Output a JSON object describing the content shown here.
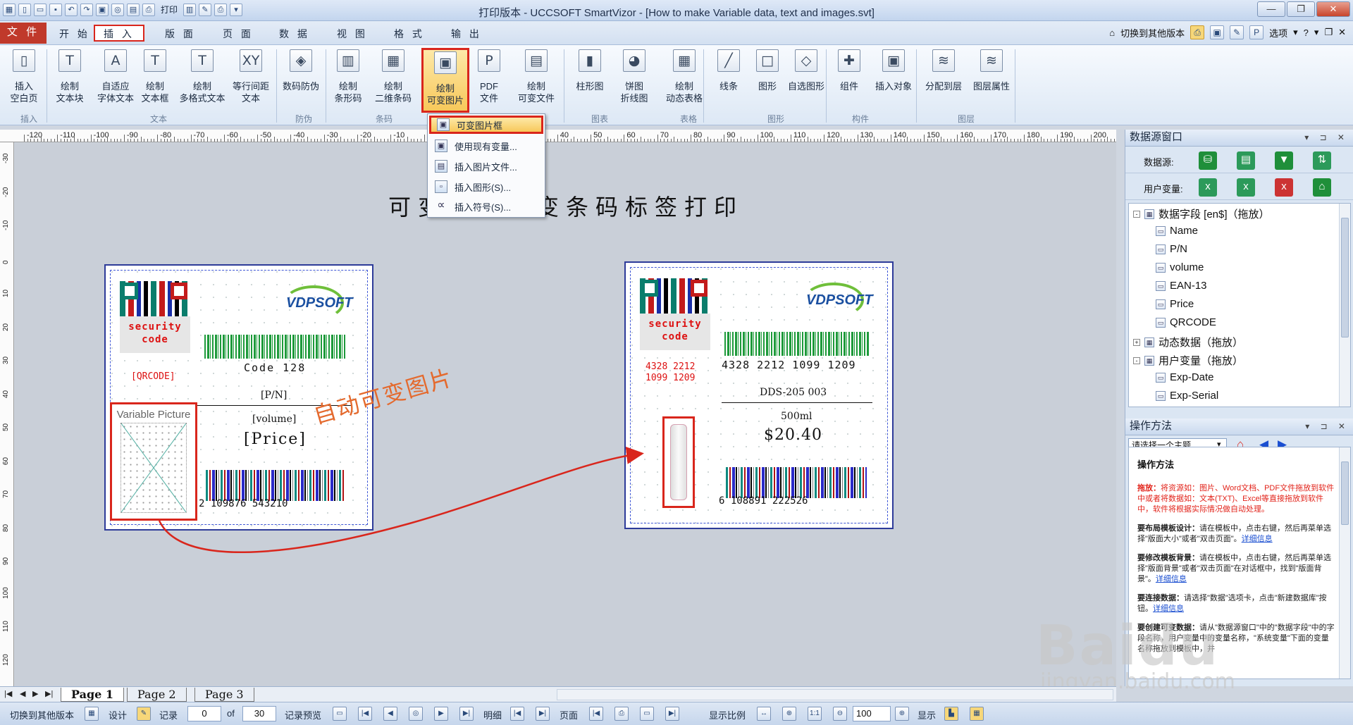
{
  "window": {
    "title": "打印版本 - UCCSOFT SmartVizor - [How to make Variable data, text and images.svt]",
    "quick_access": [
      "新建",
      "打开",
      "保存",
      "撤销",
      "重做",
      "打印",
      "预览"
    ],
    "print_label": "打印"
  },
  "menu": {
    "file": "文 件",
    "tabs": [
      "开 始",
      "插 入",
      "版 面",
      "页 面",
      "数 据",
      "视 图",
      "格 式",
      "输 出"
    ],
    "active_tab": "插 入",
    "switch_version": "切换到其他版本",
    "options": "选项"
  },
  "ribbon": {
    "buttons": [
      {
        "label": "插入\n空白页",
        "icon": "blank-page-icon",
        "glyph": "▯"
      },
      {
        "label": "绘制\n文本块",
        "icon": "text-block-icon",
        "glyph": "T"
      },
      {
        "label": "自适应\n字体文本",
        "icon": "autofit-text-icon",
        "glyph": "A"
      },
      {
        "label": "绘制\n文本框",
        "icon": "textbox-icon",
        "glyph": "T"
      },
      {
        "label": "绘制\n多格式文本",
        "icon": "rich-text-icon",
        "glyph": "T"
      },
      {
        "label": "等行间距\n文本",
        "icon": "line-spacing-icon",
        "glyph": "XY"
      },
      {
        "label": "数码防伪",
        "icon": "shield-icon",
        "glyph": "◈"
      },
      {
        "label": "绘制\n条形码",
        "icon": "barcode-icon",
        "glyph": "▥"
      },
      {
        "label": "绘制\n二维条码",
        "icon": "qrcode-icon",
        "glyph": "▦"
      },
      {
        "label": "绘制\n可变图片",
        "icon": "variable-image-icon",
        "glyph": "▣"
      },
      {
        "label": "PDF\n文件",
        "icon": "pdf-icon",
        "glyph": "P"
      },
      {
        "label": "绘制\n可变文件",
        "icon": "variable-file-icon",
        "glyph": "▤"
      },
      {
        "label": "柱形图",
        "icon": "bar-chart-icon",
        "glyph": "▮"
      },
      {
        "label": "饼图\n折线图",
        "icon": "pie-chart-icon",
        "glyph": "◕"
      },
      {
        "label": "绘制\n动态表格",
        "icon": "table-icon",
        "glyph": "▦"
      },
      {
        "label": "线条",
        "icon": "line-icon",
        "glyph": "╱"
      },
      {
        "label": "图形",
        "icon": "shape-icon",
        "glyph": "□"
      },
      {
        "label": "自选图形",
        "icon": "custom-shape-icon",
        "glyph": "◇"
      },
      {
        "label": "组件",
        "icon": "component-icon",
        "glyph": "✚"
      },
      {
        "label": "插入对象",
        "icon": "object-icon",
        "glyph": "▣"
      },
      {
        "label": "分配到层",
        "icon": "assign-layer-icon",
        "glyph": "≋"
      },
      {
        "label": "图层属性",
        "icon": "layer-props-icon",
        "glyph": "≋"
      }
    ],
    "groups": [
      "插入",
      "文本",
      "防伪",
      "条码",
      "图表",
      "表格",
      "图形",
      "构件",
      "图层"
    ]
  },
  "dropdown": {
    "items": [
      {
        "label": "可变图片框",
        "icon": "image-frame-icon"
      },
      {
        "label": "使用现有变量...",
        "icon": "existing-variable-icon"
      },
      {
        "label": "插入图片文件...",
        "icon": "image-file-icon"
      },
      {
        "label": "插入图形(S)...",
        "icon": "insert-shape-icon"
      },
      {
        "label": "插入符号(S)...",
        "icon": "symbol-icon"
      }
    ]
  },
  "ruler": {
    "top_labels": [
      "-120",
      "-110",
      "-100",
      "-90",
      "-80",
      "-70",
      "-60",
      "-50",
      "-40",
      "-30",
      "-20",
      "-10",
      "0",
      "10",
      "20",
      "30",
      "40",
      "50",
      "60",
      "70",
      "80",
      "90",
      "100",
      "110",
      "120",
      "130",
      "140",
      "150",
      "160",
      "170",
      "180",
      "190",
      "200"
    ],
    "left_labels": [
      "-30",
      "-20",
      "-10",
      "0",
      "10",
      "20",
      "30",
      "40",
      "50",
      "60",
      "70",
      "80",
      "90",
      "100",
      "110",
      "120"
    ]
  },
  "canvas": {
    "title": "可变图片可变条码标签打印",
    "annotation": "自动可变图片",
    "label_left": {
      "security": "security\ncode",
      "qr_field": "[QRCODE]",
      "code128": "Code 128",
      "pn": "[P/N]",
      "volume": "[volume]",
      "price": "[Price]",
      "ean_digits": "2  109876   543210",
      "picture": "Variable Picture",
      "logo": "VDPSOFT"
    },
    "label_right": {
      "security": "security\ncode",
      "qr_text": "4328 2212\n1099 1209",
      "code128_digits": "4328  2212  1099  1209",
      "pn": "DDS-205 003",
      "volume": "500ml",
      "price": "$20.40",
      "ean_digits": "6  108891   222526",
      "logo": "VDPSOFT"
    }
  },
  "datasource": {
    "title": "数据源窗口",
    "datasource_label": "数据源:",
    "uservar_label": "用户变量:",
    "tree": [
      {
        "label": "数据字段 [en$]（拖放）",
        "level": 0,
        "toggle": "-"
      },
      {
        "label": "Name",
        "level": 1
      },
      {
        "label": "P/N",
        "level": 1
      },
      {
        "label": "volume",
        "level": 1
      },
      {
        "label": "EAN-13",
        "level": 1
      },
      {
        "label": "Price",
        "level": 1
      },
      {
        "label": "QRCODE",
        "level": 1
      },
      {
        "label": "动态数据（拖放）",
        "level": 0,
        "toggle": "+"
      },
      {
        "label": "用户变量（拖放）",
        "level": 0,
        "toggle": "-"
      },
      {
        "label": "Exp-Date",
        "level": 1
      },
      {
        "label": "Exp-Serial",
        "level": 1
      }
    ]
  },
  "operation": {
    "title": "操作方法",
    "select_placeholder": "请选择一个主题...",
    "heading": "操作方法",
    "p1_lead": "拖放：",
    "p1": "将资源如：图片、Word文档、PDF文件拖放到软件中或者将数据如：文本(TXT)、Excel等直接拖放到软件中，软件将根据实际情况做自动处理。",
    "p2_lead": "要布局模板设计：",
    "p2": "请在模板中，点击右键，然后再菜单选择\"版面大小\"或者\"双击页面\"。",
    "p2_link": "详细信息",
    "p3_lead": "要修改模板背景：",
    "p3": "请在模板中，点击右键，然后再菜单选择\"版面背景\"或者\"双击页面\"在对话框中，找到\"版面背景\"。",
    "p3_link": "详细信息",
    "p4_lead": "要连接数据：",
    "p4": "请选择\"数据\"选项卡，点击\"新建数据库\"按钮。",
    "p4_link": "详细信息",
    "p5_lead": "要创建可变数据：",
    "p5": "请从\"数据源窗口\"中的\"数据字段\"中的字段名称，用户变量中的变量名称，\"系统变量\"下面的变量名称拖放到模板中，并"
  },
  "watermark": {
    "main": "Baidu",
    "sub": "jingyan.baidu.com"
  },
  "pages": {
    "tabs": [
      "Page 1",
      "Page 2",
      "Page 3"
    ],
    "current": "Page 1"
  },
  "status": {
    "switch_version": "切换到其他版本",
    "design": "设计",
    "record": "记录",
    "record_current": "0",
    "of": "of",
    "record_total": "30",
    "record_preview": "记录预览",
    "detail": "明细",
    "page": "页面",
    "zoom_label": "显示比例",
    "zoom_value": "100",
    "show": "显示"
  }
}
